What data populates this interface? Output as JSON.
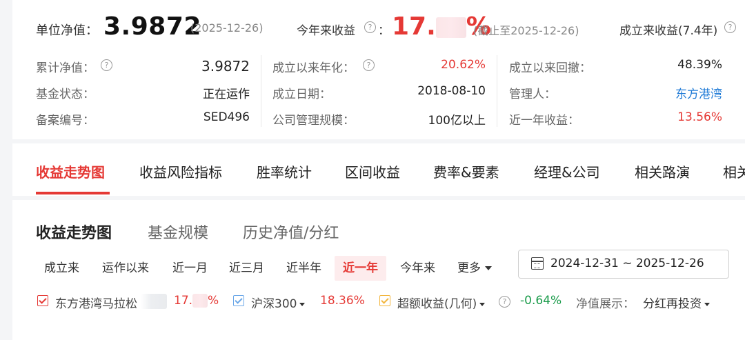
{
  "header": {
    "nav_label": "单位净值：",
    "nav_value": "3.9872",
    "nav_date": "(2025-12-26)",
    "ytd_label": "今年来收益",
    "ytd_colon": "：",
    "ytd_value_visible": "17.",
    "ytd_value_tail": "%",
    "ytd_asof": "(截止至2025-12-26)",
    "since_label": "成立来收益(7.4年)"
  },
  "stats": [
    {
      "label": "累计净值：",
      "value": "3.9872",
      "help": true
    },
    {
      "label": "成立以来年化：",
      "value": "20.62%",
      "help": true,
      "color": "red"
    },
    {
      "label": "成立以来回撤：",
      "value": "48.39%"
    },
    {
      "label": "基金状态：",
      "value": "正在运作"
    },
    {
      "label": "成立日期：",
      "value": "2018-08-10"
    },
    {
      "label": "管理人：",
      "value": "东方港湾",
      "color": "blue"
    },
    {
      "label": "备案编号：",
      "value": "SED496"
    },
    {
      "label": "公司管理规模：",
      "value": "100亿以上"
    },
    {
      "label": "近一年收益：",
      "value": "13.56%",
      "color": "red"
    }
  ],
  "tabs": [
    "收益走势图",
    "收益风险指标",
    "胜率统计",
    "区间收益",
    "费率&要素",
    "经理&公司",
    "相关路演",
    "相关"
  ],
  "active_tab": 0,
  "subtabs": [
    "收益走势图",
    "基金规模",
    "历史净值/分红"
  ],
  "active_subtab": 0,
  "ranges": [
    "成立来",
    "运作以来",
    "近一月",
    "近三月",
    "近半年",
    "近一年",
    "今年来",
    "更多"
  ],
  "active_range": 5,
  "date_range": "2024-12-31 ~ 2025-12-26",
  "legend": {
    "fund_name": "东方港湾马拉松",
    "fund_value": "17.",
    "fund_value_tail": "%",
    "index_name": "沪深300",
    "index_value": "18.36%",
    "excess_name": "超额收益(几何)",
    "excess_value": "-0.64%",
    "nav_display_label": "净值展示：",
    "nav_display_value": "分红再投资"
  },
  "colors": {
    "accent": "#e53935",
    "green": "#1a9b4a",
    "blue": "#1e7ad6",
    "index_check": "#6aa7e8",
    "excess_check": "#f2b53c"
  }
}
